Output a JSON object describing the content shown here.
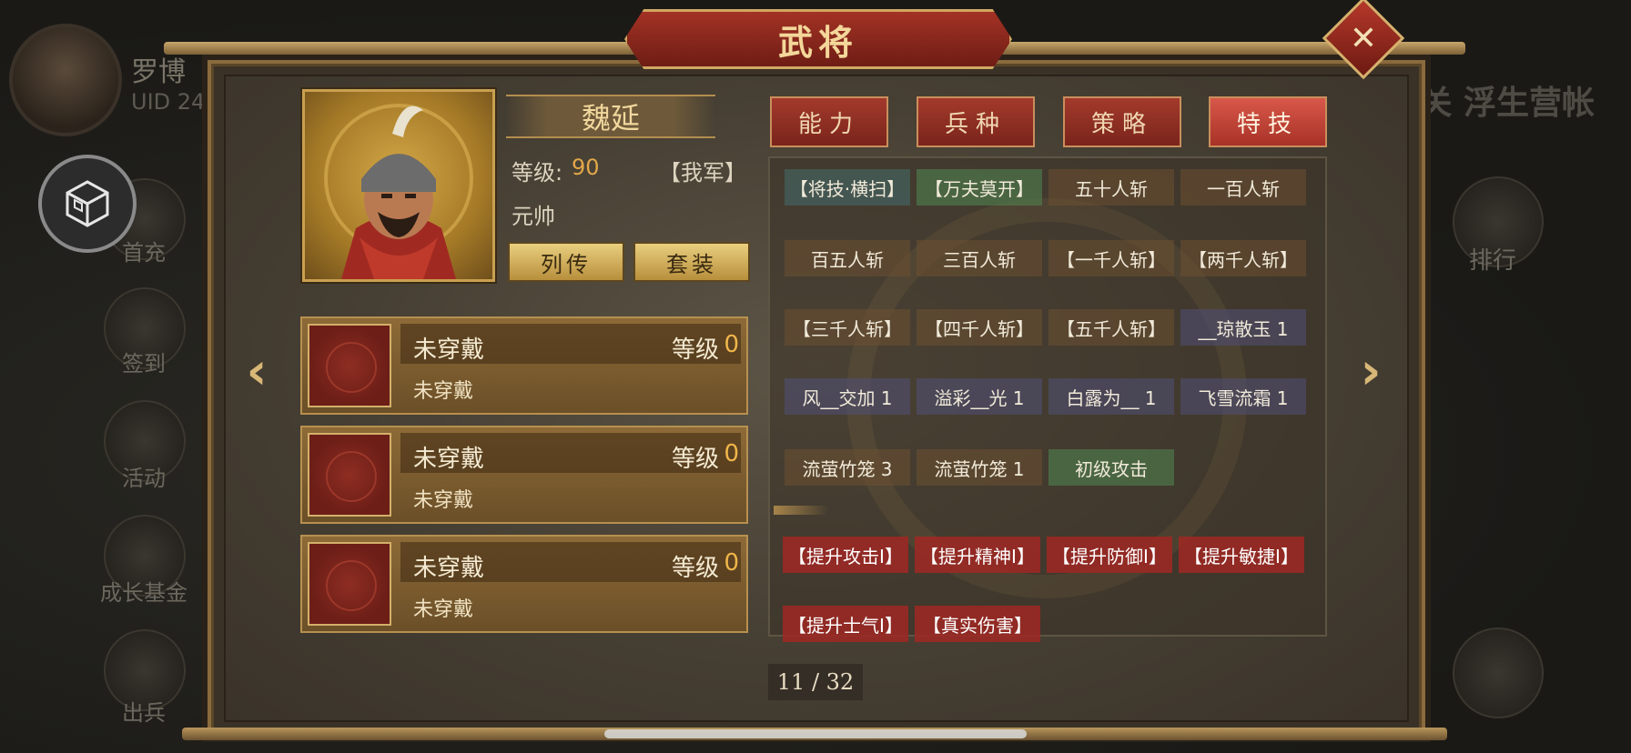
{
  "background": {
    "player_name": "罗博",
    "player_uid_label": "UID 24",
    "left_menu": [
      "首充",
      "签到",
      "活动",
      "成长基金",
      "出兵"
    ],
    "right_title": "关 浮生营帐",
    "right_menu": [
      "排行"
    ]
  },
  "dialog": {
    "title": "武将",
    "close_icon": "✕"
  },
  "hero": {
    "name": "魏延",
    "level_label": "等级:",
    "level_value": "90",
    "faction": "【我军】",
    "rank": "元帅",
    "buttons": {
      "biography": "列传",
      "outfit": "套装"
    }
  },
  "equipment": [
    {
      "name": "未穿戴",
      "level_label": "等级",
      "level_value": "0",
      "desc": "未穿戴"
    },
    {
      "name": "未穿戴",
      "level_label": "等级",
      "level_value": "0",
      "desc": "未穿戴"
    },
    {
      "name": "未穿戴",
      "level_label": "等级",
      "level_value": "0",
      "desc": "未穿戴"
    }
  ],
  "tabs": [
    {
      "label": "能力",
      "active": false
    },
    {
      "label": "兵种",
      "active": false
    },
    {
      "label": "策略",
      "active": false
    },
    {
      "label": "特技",
      "active": true
    }
  ],
  "skills": [
    {
      "label": "【将技·横扫】",
      "style": "teal"
    },
    {
      "label": "【万夫莫开】",
      "style": "green"
    },
    {
      "label": "五十人斩",
      "style": "brown"
    },
    {
      "label": "一百人斩",
      "style": "brown"
    },
    {
      "label": "百五人斩",
      "style": "brown"
    },
    {
      "label": "三百人斩",
      "style": "brown"
    },
    {
      "label": "【一千人斩】",
      "style": "brown"
    },
    {
      "label": "【两千人斩】",
      "style": "brown"
    },
    {
      "label": "【三千人斩】",
      "style": "brown"
    },
    {
      "label": "【四千人斩】",
      "style": "brown"
    },
    {
      "label": "【五千人斩】",
      "style": "brown"
    },
    {
      "label": "__琼散玉 1",
      "style": "blue"
    },
    {
      "label": "风__交加 1",
      "style": "blue"
    },
    {
      "label": "溢彩__光 1",
      "style": "blue"
    },
    {
      "label": "白露为__ 1",
      "style": "blue"
    },
    {
      "label": "飞雪流霜 1",
      "style": "blue"
    },
    {
      "label": "流萤竹笼 3",
      "style": "brown"
    },
    {
      "label": "流萤竹笼 1",
      "style": "brown"
    },
    {
      "label": "初级攻击",
      "style": "green"
    }
  ],
  "buffs": [
    {
      "label": "【提升攻击Ⅰ】"
    },
    {
      "label": "【提升精神Ⅰ】"
    },
    {
      "label": "【提升防御Ⅰ】"
    },
    {
      "label": "【提升敏捷Ⅰ】"
    },
    {
      "label": "【提升士气Ⅰ】"
    },
    {
      "label": "【真实伤害】"
    }
  ],
  "pagination": {
    "text": "11 / 32"
  },
  "nav": {
    "prev_icon": "‹",
    "next_icon": "›"
  }
}
